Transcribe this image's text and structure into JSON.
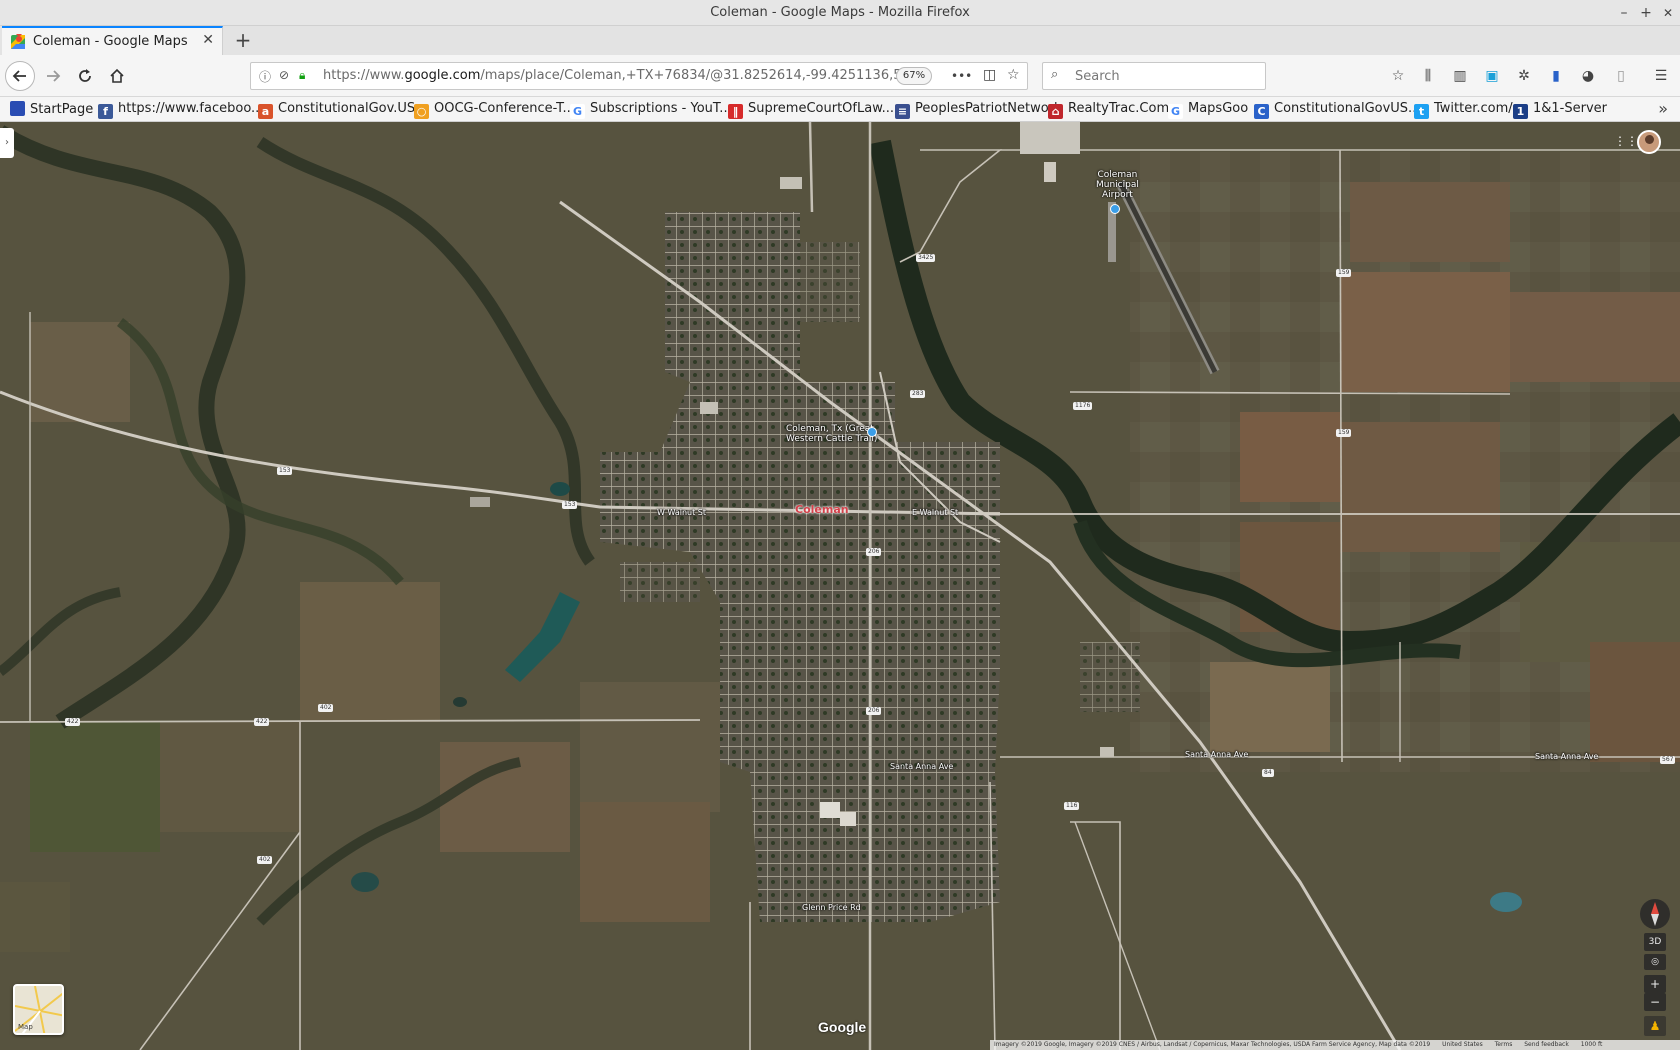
{
  "window": {
    "title": "Coleman - Google Maps - Mozilla Firefox",
    "minimize": "–",
    "maximize": "+",
    "close": "✕"
  },
  "tab": {
    "label": "Coleman - Google Maps",
    "close": "✕",
    "new_tab": "+"
  },
  "navbar": {
    "url_prefix": "https://www.",
    "url_domain": "google.com",
    "url_rest": "/maps/place/Coleman,+TX+76834/@31.8252614,-99.4251136,5654m/d",
    "zoom": "67%",
    "more": "•••",
    "search_placeholder": "Search"
  },
  "bookmarks": [
    {
      "label": "StartPage",
      "icon": "startpage-icon",
      "color": "#2a4db3",
      "glyph": ""
    },
    {
      "label": "https://www.faceboo...",
      "icon": "facebook-icon",
      "color": "#3b5998",
      "glyph": "f"
    },
    {
      "label": "ConstitutionalGov.US",
      "icon": "ask-icon",
      "color": "#d9532b",
      "glyph": "a"
    },
    {
      "label": "OOCG-Conference-T...",
      "icon": "circle-icon",
      "color": "#f0a020",
      "glyph": "○"
    },
    {
      "label": "Subscriptions - YouT...",
      "icon": "google-icon",
      "color": "#ffffff",
      "glyph": "G"
    },
    {
      "label": "SupremeCourtOfLaw...",
      "icon": "bars-icon",
      "color": "#d62a2a",
      "glyph": "‖"
    },
    {
      "label": "PeoplesPatriotNetwork",
      "icon": "flag-icon",
      "color": "#3a4f8f",
      "glyph": "≡"
    },
    {
      "label": "RealtyTrac.Com",
      "icon": "house-icon",
      "color": "#c0272d",
      "glyph": "⌂"
    },
    {
      "label": "MapsGoo",
      "icon": "google-icon",
      "color": "#ffffff",
      "glyph": "G"
    },
    {
      "label": "ConstitutionalGovUS....",
      "icon": "c-icon",
      "color": "#2a62c9",
      "glyph": "C"
    },
    {
      "label": "Twitter.com/",
      "icon": "twitter-icon",
      "color": "#1da1f2",
      "glyph": "t"
    },
    {
      "label": "1&1-Server",
      "icon": "server-icon",
      "color": "#1c3f87",
      "glyph": "1"
    }
  ],
  "map": {
    "city": "Coleman",
    "airport": [
      "Coleman",
      "Municipal",
      "Airport"
    ],
    "poi": [
      "Coleman, Tx (Great",
      "Western Cattle Trail)"
    ],
    "streets": {
      "w_walnut": "W Walnut St",
      "e_walnut": "E Walnut St",
      "santa_anna_1": "Santa Anna Ave",
      "santa_anna_2": "Santa Anna Ave",
      "santa_anna_3": "Santa Anna Ave",
      "glenn_price": "Glenn Price Rd"
    },
    "shields": {
      "r153a": "153",
      "r153b": "153",
      "r206a": "206",
      "r206b": "206",
      "r283": "283",
      "r84": "84",
      "r159a": "159",
      "r159b": "159",
      "r567": "567",
      "r3425": "3425",
      "r422a": "422",
      "r422b": "422",
      "r402a": "402",
      "r402b": "402",
      "r116": "116",
      "r1176": "1176"
    },
    "minimap_label": "Map",
    "btn_3d": "3D",
    "zoom_in": "+",
    "zoom_out": "−",
    "google": "Google",
    "attribution": [
      "Imagery ©2019 Google, Imagery ©2019 CNES / Airbus, Landsat / Copernicus, Maxar Technologies, USDA Farm Service Agency, Map data ©2019",
      "United States",
      "Terms",
      "Send feedback",
      "1000 ft"
    ]
  }
}
